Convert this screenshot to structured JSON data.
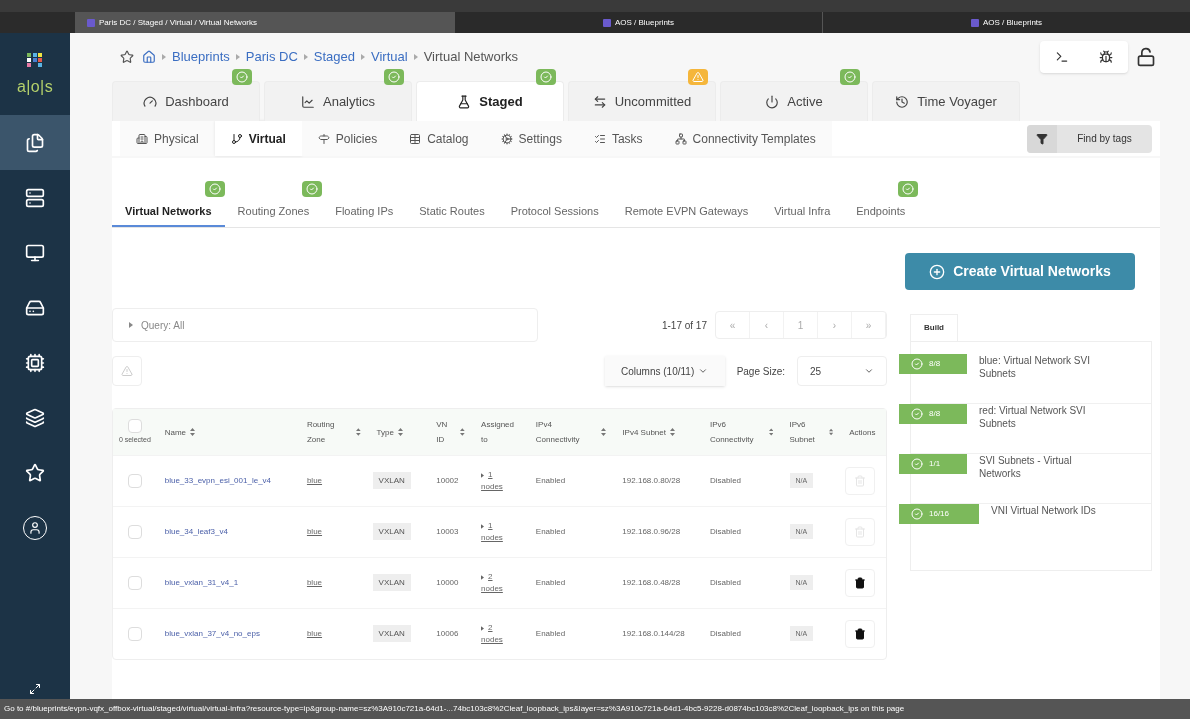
{
  "browser_tabs": [
    {
      "title": "Paris DC / Staged / Virtual / Virtual Networks",
      "selected": true
    },
    {
      "title": "AOS / Blueprints",
      "selected": false
    },
    {
      "title": "AOS / Blueprints",
      "selected": false
    }
  ],
  "sidebar": {
    "logo_text": "a|o|s",
    "items": [
      {
        "selected": true
      },
      {
        "selected": false
      },
      {
        "selected": false
      },
      {
        "selected": false
      },
      {
        "selected": false
      },
      {
        "selected": false
      },
      {
        "selected": false
      },
      {
        "selected": false
      }
    ]
  },
  "breadcrumb": [
    "Blueprints",
    "Paris DC",
    "Staged",
    "Virtual",
    "Virtual Networks"
  ],
  "main_tabs": [
    {
      "label": "Dashboard",
      "ok": true,
      "warning": false,
      "selected": false
    },
    {
      "label": "Analytics",
      "ok": true,
      "warning": false,
      "selected": false
    },
    {
      "label": "Staged",
      "ok": true,
      "warning": false,
      "selected": true
    },
    {
      "label": "Uncommitted",
      "ok": false,
      "warning": true,
      "selected": false
    },
    {
      "label": "Active",
      "ok": true,
      "warning": false,
      "selected": false
    },
    {
      "label": "Time Voyager",
      "ok": false,
      "warning": false,
      "selected": false
    }
  ],
  "sub_tabs": [
    {
      "label": "Physical",
      "selected": false
    },
    {
      "label": "Virtual",
      "selected": true
    },
    {
      "label": "Policies",
      "selected": false
    },
    {
      "label": "Catalog",
      "selected": false
    },
    {
      "label": "Settings",
      "selected": false
    },
    {
      "label": "Tasks",
      "selected": false
    },
    {
      "label": "Connectivity Templates",
      "selected": false
    }
  ],
  "find_by_tags": "Find by tags",
  "virtual_tabs": [
    {
      "label": "Virtual Networks",
      "ok": true,
      "selected": true
    },
    {
      "label": "Routing Zones",
      "ok": true,
      "selected": false
    },
    {
      "label": "Floating IPs",
      "ok": false,
      "selected": false
    },
    {
      "label": "Static Routes",
      "ok": false,
      "selected": false
    },
    {
      "label": "Protocol Sessions",
      "ok": false,
      "selected": false
    },
    {
      "label": "Remote EVPN Gateways",
      "ok": false,
      "selected": false
    },
    {
      "label": "Virtual Infra",
      "ok": false,
      "selected": false
    },
    {
      "label": "Endpoints",
      "ok": true,
      "selected": false
    }
  ],
  "create_button": "Create Virtual Networks",
  "query": "Query: All",
  "pagination": {
    "summary": "1-17 of 17",
    "buttons": [
      "«",
      "‹",
      "1",
      "›",
      "»"
    ]
  },
  "columns_button": "Columns (10/11)",
  "page_size": {
    "label": "Page Size:",
    "value": "25"
  },
  "table": {
    "selected_count": "0 selected",
    "all_checked": false,
    "columns": [
      {
        "label": "Name",
        "sortable": true
      },
      {
        "label": "Routing Zone",
        "sortable": true
      },
      {
        "label": "Type",
        "sortable": true
      },
      {
        "label": "VN ID",
        "sortable": true
      },
      {
        "label": "Assigned to",
        "sortable": false
      },
      {
        "label": "IPv4 Connectivity",
        "sortable": true
      },
      {
        "label": "IPv4 Subnet",
        "sortable": true
      },
      {
        "label": "IPv6 Connectivity",
        "sortable": true
      },
      {
        "label": "IPv6 Subnet",
        "sortable": true
      },
      {
        "label": "Actions",
        "sortable": false
      }
    ],
    "rows": [
      {
        "checked": false,
        "name": "blue_33_evpn_esi_001_le_v4",
        "zone": "blue",
        "type": "VXLAN",
        "vn_id": "10002",
        "assigned": "1",
        "assigned_unit": "nodes",
        "ipv4": "Enabled",
        "ipv4_subnet": "192.168.0.80/28",
        "ipv6": "Disabled",
        "ipv6_subnet": "N/A",
        "delete_disabled": true
      },
      {
        "checked": false,
        "name": "blue_34_leaf3_v4",
        "zone": "blue",
        "type": "VXLAN",
        "vn_id": "10003",
        "assigned": "1",
        "assigned_unit": "nodes",
        "ipv4": "Enabled",
        "ipv4_subnet": "192.168.0.96/28",
        "ipv6": "Disabled",
        "ipv6_subnet": "N/A",
        "delete_disabled": true
      },
      {
        "checked": false,
        "name": "blue_vxlan_31_v4_1",
        "zone": "blue",
        "type": "VXLAN",
        "vn_id": "10000",
        "assigned": "2",
        "assigned_unit": "nodes",
        "ipv4": "Enabled",
        "ipv4_subnet": "192.168.0.48/28",
        "ipv6": "Disabled",
        "ipv6_subnet": "N/A",
        "delete_disabled": false
      },
      {
        "checked": false,
        "name": "blue_vxlan_37_v4_no_eps",
        "zone": "blue",
        "type": "VXLAN",
        "vn_id": "10006",
        "assigned": "2",
        "assigned_unit": "nodes",
        "ipv4": "Enabled",
        "ipv4_subnet": "192.168.0.144/28",
        "ipv6": "Disabled",
        "ipv6_subnet": "N/A",
        "delete_disabled": false
      }
    ]
  },
  "build_panel": {
    "tab": "Build",
    "items": [
      {
        "count": "8/8",
        "label": "blue: Virtual Network SVI Subnets"
      },
      {
        "count": "8/8",
        "label": "red: Virtual Network SVI Subnets"
      },
      {
        "count": "1/1",
        "label": "SVI Subnets - Virtual Networks"
      },
      {
        "count": "16/16",
        "label": "VNI Virtual Network IDs"
      }
    ]
  },
  "status_bar": "Go to #/blueprints/evpn-vqfx_offbox-virtual/staged/virtual/virtual-infra?resource-type=ip&group-name=sz%3A910c721a-64d1-...74bc103c8%2Cleaf_loopback_ips&layer=sz%3A910c721a-64d1-4bc5-9228-d0874bc103c8%2Cleaf_loopback_ips on this page"
}
